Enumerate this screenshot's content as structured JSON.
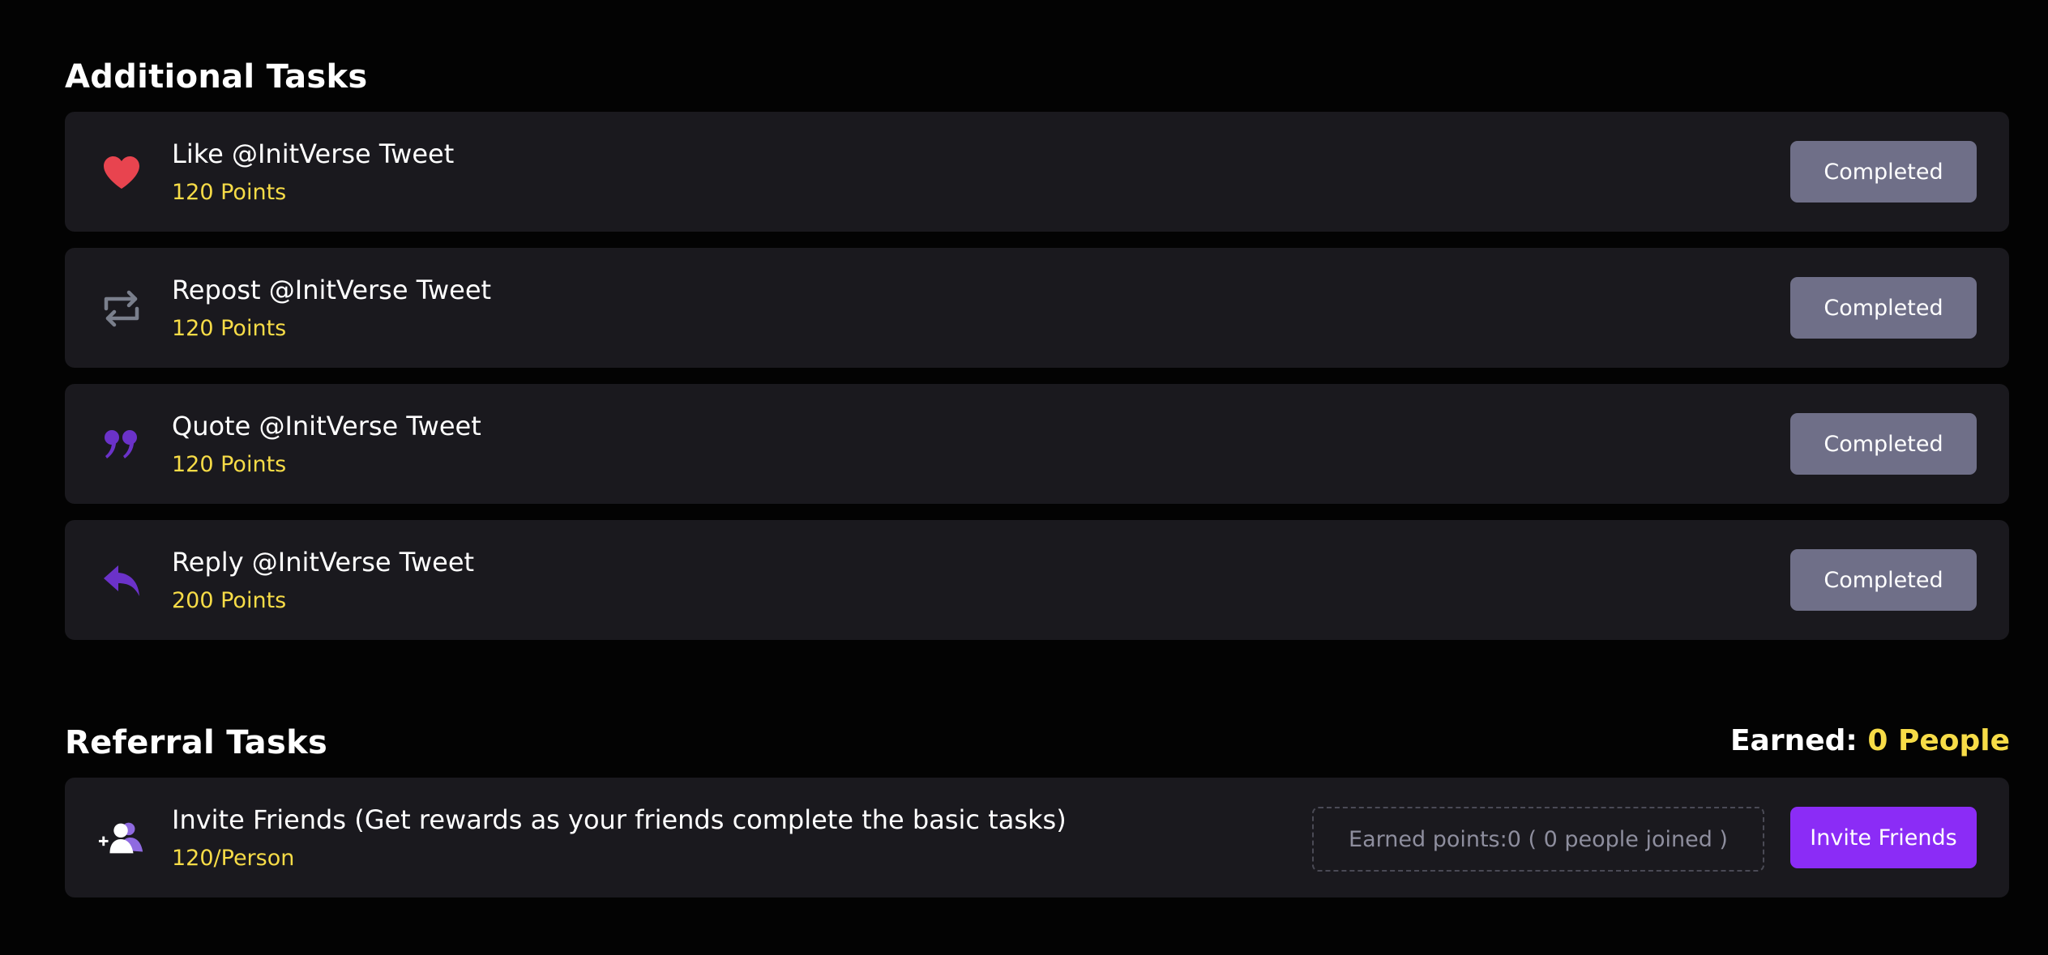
{
  "additional": {
    "title": "Additional Tasks",
    "tasks": [
      {
        "icon": "heart-icon",
        "title": "Like @InitVerse Tweet",
        "points": "120 Points",
        "button": "Completed"
      },
      {
        "icon": "repost-icon",
        "title": "Repost @InitVerse Tweet",
        "points": "120 Points",
        "button": "Completed"
      },
      {
        "icon": "quote-icon",
        "title": "Quote @InitVerse Tweet",
        "points": "120 Points",
        "button": "Completed"
      },
      {
        "icon": "reply-icon",
        "title": "Reply @InitVerse Tweet",
        "points": "200 Points",
        "button": "Completed"
      }
    ]
  },
  "referral": {
    "title": "Referral Tasks",
    "earned_label": "Earned:",
    "earned_value": "0 People",
    "task": {
      "icon": "add-friends-icon",
      "title": "Invite Friends (Get rewards as your friends complete the basic tasks)",
      "points": "120/Person",
      "earned_box": "Earned points:0 ( 0 people joined )",
      "button": "Invite Friends"
    }
  },
  "colors": {
    "background": "#030303",
    "card": "#1a191e",
    "points": "#f7dc47",
    "completed_button": "#6f6f88",
    "invite_button": "#8b2cf6",
    "heart": "#e8444f",
    "purple_icon": "#6b32c9",
    "repost_icon": "#7a7f8c"
  }
}
